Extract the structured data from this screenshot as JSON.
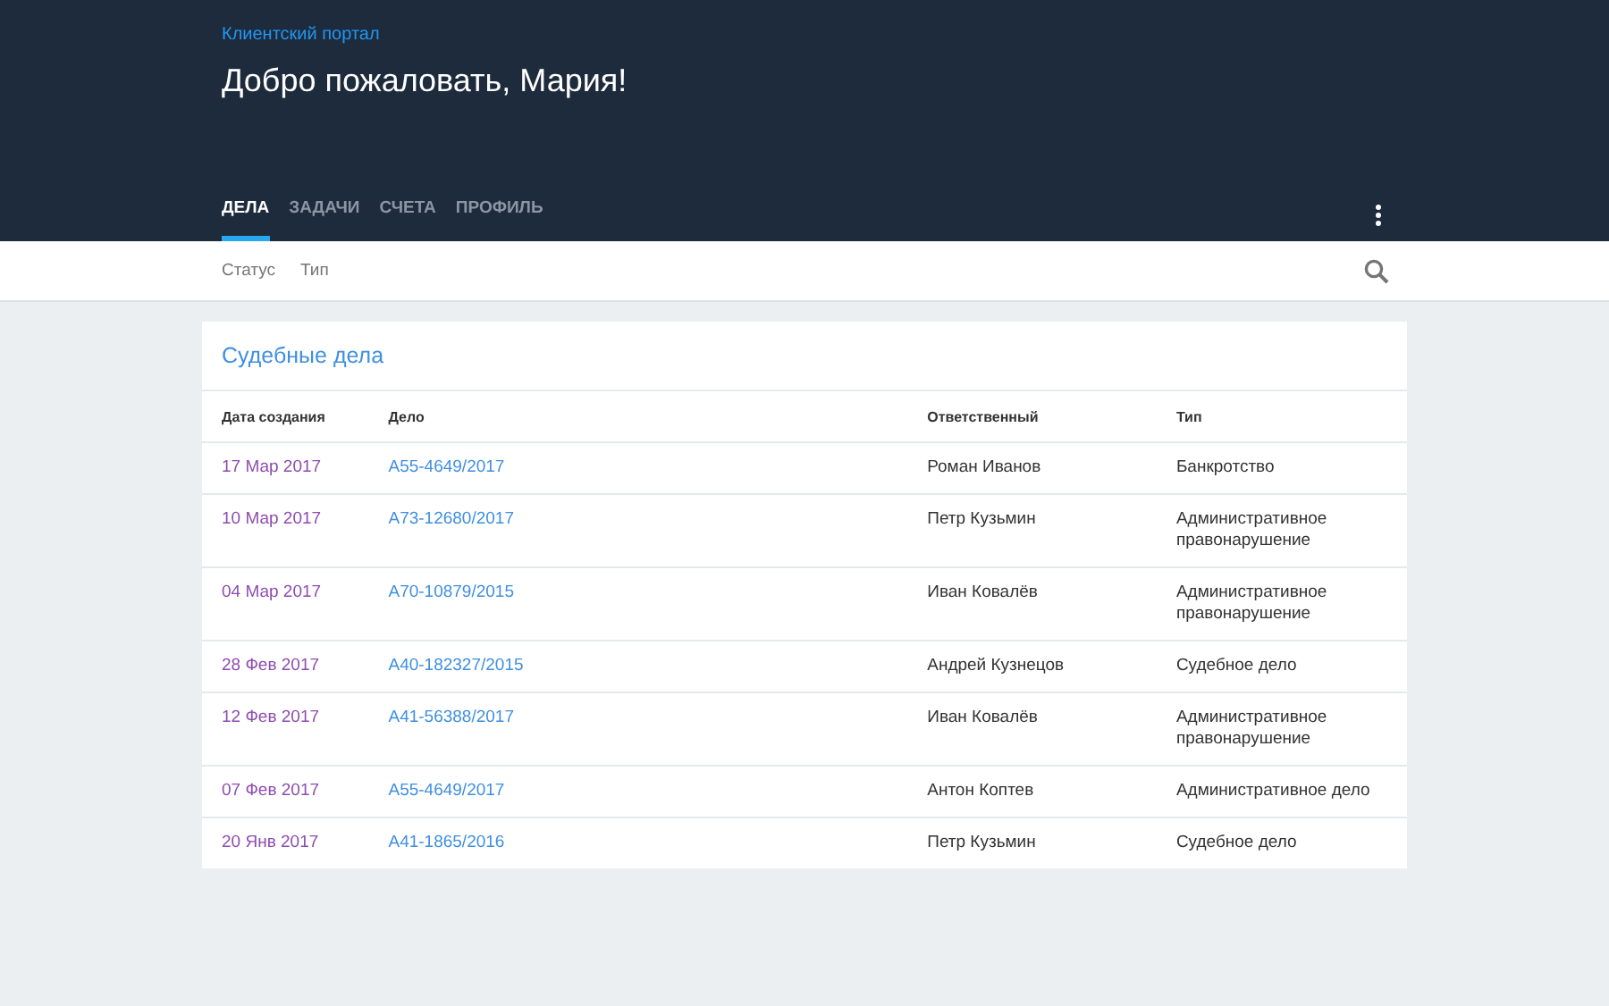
{
  "header": {
    "portal_name": "Клиентский портал",
    "greeting": "Добро пожаловать, Мария!"
  },
  "tabs": [
    {
      "label": "ДЕЛА",
      "selected": true
    },
    {
      "label": "ЗАДАЧИ",
      "selected": false
    },
    {
      "label": "СЧЕТА",
      "selected": false
    },
    {
      "label": "ПРОФИЛЬ",
      "selected": false
    }
  ],
  "filters": [
    "Статус",
    "Тип"
  ],
  "card": {
    "title": "Судебные дела",
    "columns": [
      "Дата создания",
      "Дело",
      "Ответственный",
      "Тип"
    ],
    "rows": [
      {
        "date": "17 Мар 2017",
        "case": "А55-4649/2017",
        "responsible": "Роман Иванов",
        "type": "Банкротство"
      },
      {
        "date": "10 Мар 2017",
        "case": "А73-12680/2017",
        "responsible": "Петр Кузьмин",
        "type": "Административное правонарушение"
      },
      {
        "date": "04 Мар 2017",
        "case": "А70-10879/2015",
        "responsible": "Иван Ковалёв",
        "type": "Административное правонарушение"
      },
      {
        "date": "28 Фев 2017",
        "case": "А40-182327/2015",
        "responsible": "Андрей Кузнецов",
        "type": "Судебное дело"
      },
      {
        "date": "12 Фев 2017",
        "case": "А41-56388/2017",
        "responsible": "Иван Ковалёв",
        "type": "Административное правонарушение"
      },
      {
        "date": "07 Фев 2017",
        "case": "А55-4649/2017",
        "responsible": "Антон Коптев",
        "type": "Административное дело"
      },
      {
        "date": "20 Янв 2017",
        "case": "А41-1865/2016",
        "responsible": "Петр Кузьмин",
        "type": "Судебное дело"
      }
    ]
  }
}
